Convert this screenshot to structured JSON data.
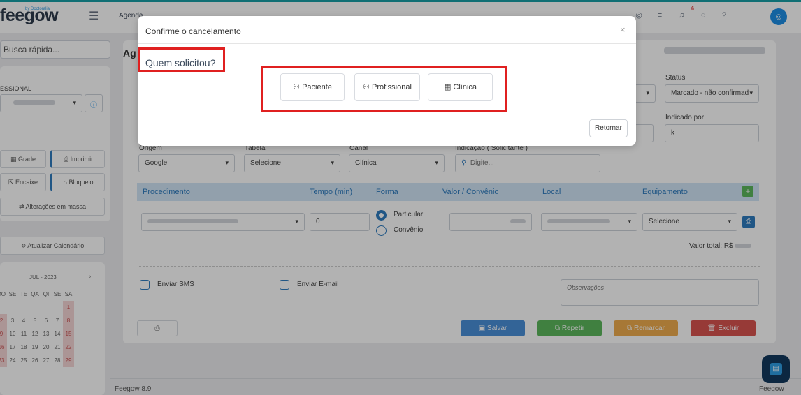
{
  "topbar": {
    "logo": "feegow",
    "logo_by": "by Doctoralia",
    "menu_partial": "Agenda",
    "badge_count": "4"
  },
  "sidebar": {
    "search_placeholder": "Busca rápida...",
    "profissional_label": "ESSIONAL",
    "buttons": {
      "grade": "Grade",
      "imprimir": "Imprimir",
      "encaixe": "Encaixe",
      "bloqueio": "Bloqueio",
      "alteracoes": "Alterações em massa",
      "atualizar": "Atualizar Calendário"
    },
    "calendar": {
      "month": "JUL - 2023",
      "weekdays": [
        "DO",
        "SE",
        "TE",
        "QA",
        "QI",
        "SE",
        "SA"
      ],
      "rows": [
        [
          "",
          "",
          "",
          "",
          "",
          "",
          "1"
        ],
        [
          "2",
          "3",
          "4",
          "5",
          "6",
          "7",
          "8"
        ],
        [
          "9",
          "10",
          "11",
          "12",
          "13",
          "14",
          "15"
        ],
        [
          "16",
          "17",
          "18",
          "19",
          "20",
          "21",
          "22"
        ],
        [
          "23",
          "24",
          "25",
          "26",
          "27",
          "28",
          "29"
        ]
      ]
    }
  },
  "main": {
    "title_partial": "Ag",
    "status_label": "Status",
    "status_value": "Marcado - não confirmad",
    "indicado_label": "Indicado por",
    "indicado_value": "k",
    "origem_label": "Origem",
    "origem_value": "Google",
    "tabela_label": "Tabela",
    "tabela_value": "Selecione",
    "canal_label": "Canal",
    "canal_value": "Clínica",
    "indicacao_label": "Indicação ( Solicitante )",
    "indicacao_placeholder": "Digite...",
    "table_headers": [
      "Procedimento",
      "Tempo (min)",
      "Forma",
      "Valor / Convênio",
      "Local",
      "Equipamento"
    ],
    "tempo_value": "0",
    "forma_particular": "Particular",
    "forma_convenio": "Convênio",
    "equipamento_value": "Selecione",
    "valor_total": "Valor total: R$",
    "enviar_sms": "Enviar SMS",
    "enviar_email": "Enviar E-mail",
    "observacoes_placeholder": "Observações",
    "buttons": {
      "salvar": "Salvar",
      "repetir": "Repetir",
      "remarcar": "Remarcar",
      "excluir": "Excluir"
    },
    "footer": "Feegow 8.9",
    "footer_right": "Feegow"
  },
  "modal": {
    "title": "Confirme o cancelamento",
    "question": "Quem solicitou?",
    "options": [
      "Paciente",
      "Profissional",
      "Clínica"
    ],
    "retornar": "Retornar"
  },
  "colors": {
    "accent": "#1d8fe6",
    "highlight": "#e02020",
    "salvar": "#4a90d9",
    "repetir": "#5cb85c",
    "remarcar": "#f0ad4e",
    "excluir": "#d9534f"
  }
}
